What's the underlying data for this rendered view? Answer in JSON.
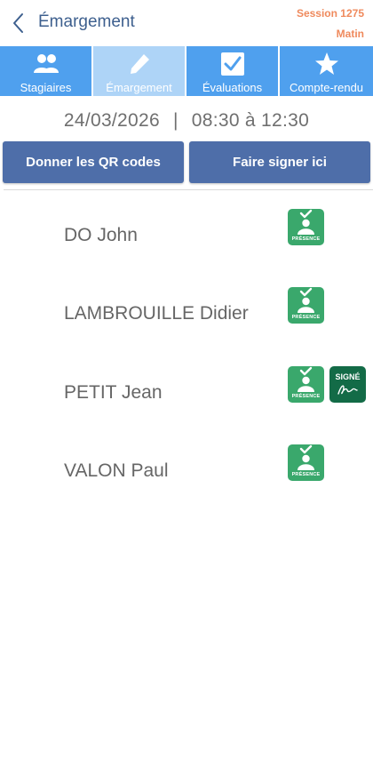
{
  "header": {
    "title": "Émargement",
    "session": "Session 1275",
    "period": "Matin"
  },
  "tabs": [
    {
      "label": "Stagiaires",
      "icon": "users-icon",
      "active": false
    },
    {
      "label": "Émargement",
      "icon": "pencil-icon",
      "active": true
    },
    {
      "label": "Évaluations",
      "icon": "checkbox-icon",
      "active": false
    },
    {
      "label": "Compte-rendu",
      "icon": "star-icon",
      "active": false
    }
  ],
  "schedule": {
    "date": "24/03/2026",
    "separator": "|",
    "time": "08:30 à 12:30"
  },
  "actions": {
    "qr_codes": "Donner les QR codes",
    "sign_here": "Faire signer ici"
  },
  "badges": {
    "presence": "PRÉSENCE",
    "signed": "SIGNÉ"
  },
  "trainees": [
    {
      "name": "DO John",
      "presence": true,
      "signed": false
    },
    {
      "name": "LAMBROUILLE Didier",
      "presence": true,
      "signed": false
    },
    {
      "name": "PETIT Jean",
      "presence": true,
      "signed": true
    },
    {
      "name": "VALON Paul",
      "presence": true,
      "signed": false
    }
  ],
  "colors": {
    "title": "#3d5f8e",
    "session": "#ef8a5d",
    "tab": "#4fa0ee",
    "tab_active": "#aed4f7",
    "action_button": "#4e6ea9",
    "presence_badge": "#3aa86c",
    "signed_badge": "#136b47"
  }
}
